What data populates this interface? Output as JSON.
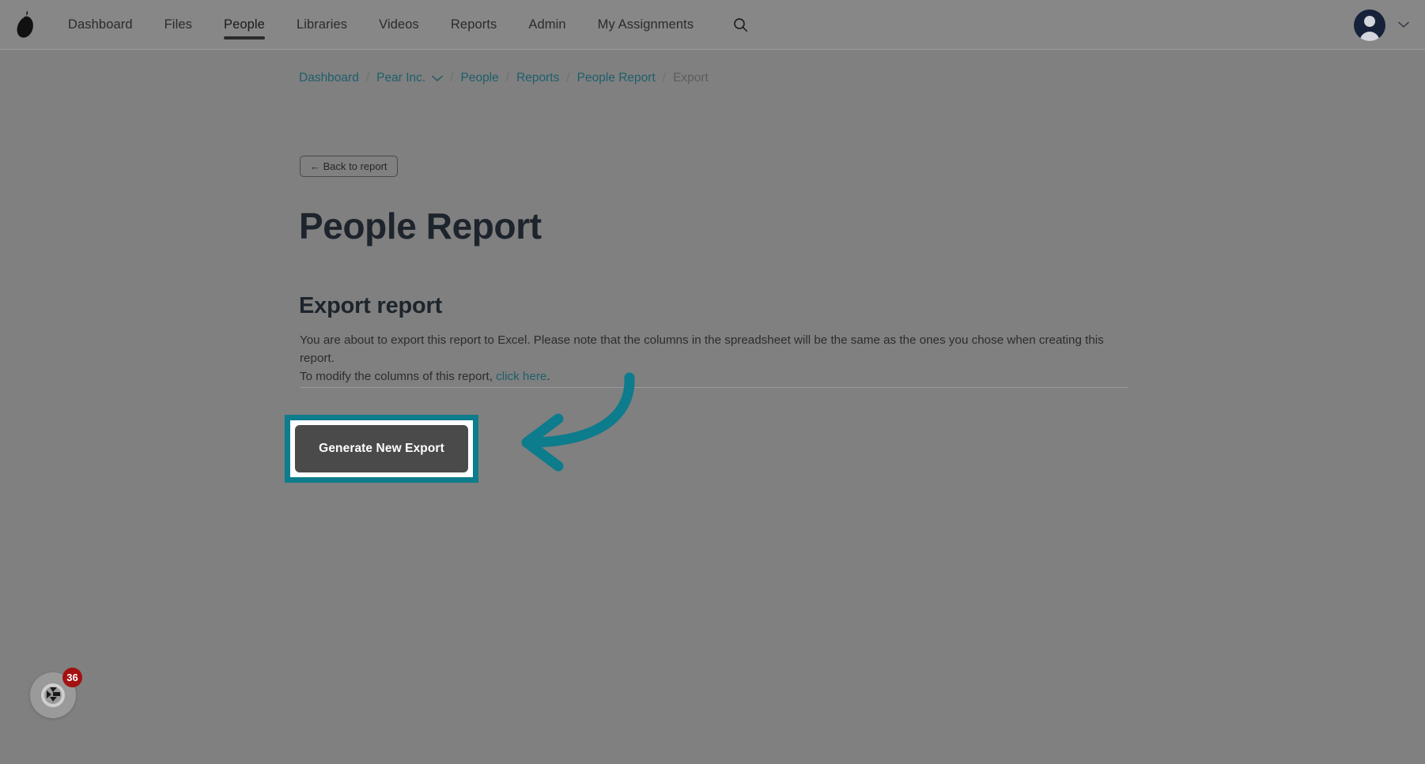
{
  "topnav": {
    "logo_icon": "pear-logo-icon",
    "items": [
      {
        "label": "Dashboard",
        "active": false
      },
      {
        "label": "Files",
        "active": false
      },
      {
        "label": "People",
        "active": true
      },
      {
        "label": "Libraries",
        "active": false
      },
      {
        "label": "Videos",
        "active": false
      },
      {
        "label": "Reports",
        "active": false
      },
      {
        "label": "Admin",
        "active": false
      },
      {
        "label": "My Assignments",
        "active": false
      }
    ],
    "search_icon": "search-icon",
    "avatar_icon": "user-avatar-icon",
    "avatar_caret_icon": "chevron-down-icon"
  },
  "breadcrumb": {
    "items": [
      {
        "label": "Dashboard",
        "link": true
      },
      {
        "label": "Pear Inc.",
        "link": true,
        "caret": true
      },
      {
        "label": "People",
        "link": true
      },
      {
        "label": "Reports",
        "link": true
      },
      {
        "label": "People Report",
        "link": true
      },
      {
        "label": "Export",
        "link": false
      }
    ],
    "separator": "/"
  },
  "back_button": {
    "label": "← Back to report"
  },
  "page": {
    "title": "People Report",
    "section_title": "Export report",
    "body_line1": "You are about to export this report to Excel. Please note that the columns in the spreadsheet will be the same as the ones you chose when creating this report.",
    "body_line2_prefix": "To modify the columns of this report, ",
    "body_link": "click here",
    "body_line2_suffix": "."
  },
  "cta": {
    "generate_label": "Generate New Export",
    "highlight_color": "#0d7c8c",
    "button_bg": "#4a4a4a",
    "button_text_color": "#ffffff"
  },
  "annotation": {
    "arrow_icon": "curved-left-arrow-icon",
    "arrow_color": "#0d7c8c"
  },
  "help_widget": {
    "icon": "help-widget-icon",
    "badge_count": "36",
    "badge_color": "#a31111"
  }
}
